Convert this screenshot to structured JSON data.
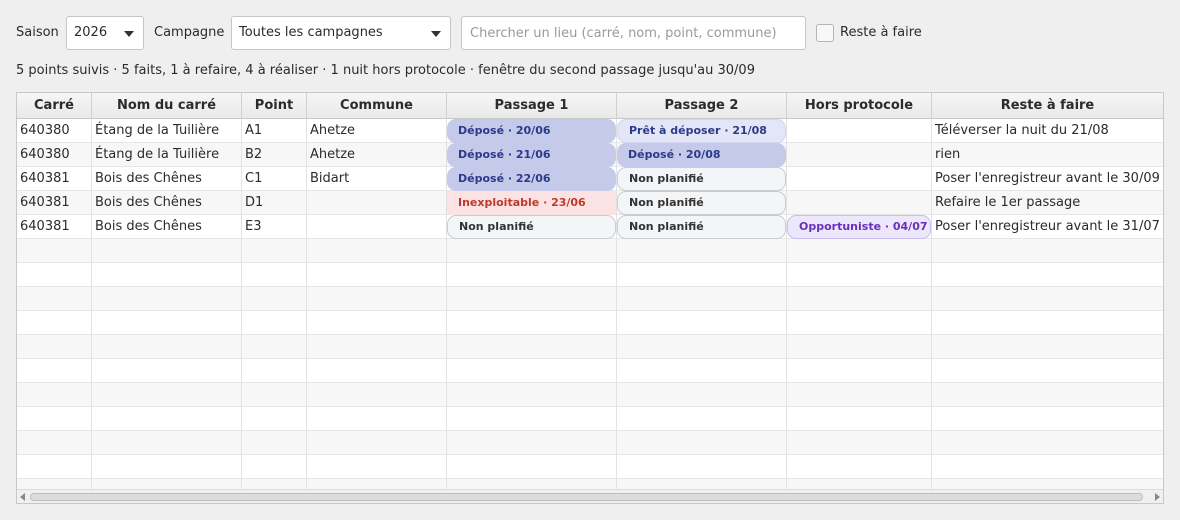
{
  "filters": {
    "season_label": "Saison",
    "season_value": "2026",
    "campaign_label": "Campagne",
    "campaign_value": "Toutes les campagnes",
    "search_placeholder": "Chercher un lieu (carré, nom, point, commune)",
    "search_value": "",
    "remaining_checkbox_label": "Reste à faire",
    "remaining_checked": false
  },
  "summary": "5 points suivis · 5 faits, 1 à refaire, 4 à réaliser · 1 nuit hors protocole · fenêtre du second passage jusqu'au 30/09",
  "table": {
    "columns": [
      "Carré",
      "Nom du carré",
      "Point",
      "Commune",
      "Passage 1",
      "Passage 2",
      "Hors protocole",
      "Reste à faire"
    ],
    "rows": [
      {
        "carre": "640380",
        "nom": "Étang de la Tuilière",
        "point": "A1",
        "commune": "Ahetze",
        "passage1": {
          "text": "Déposé · 20/06",
          "status": "depose"
        },
        "passage2": {
          "text": "Prêt à déposer · 21/08",
          "status": "pret"
        },
        "hors": null,
        "reste": "Téléverser la nuit du 21/08"
      },
      {
        "carre": "640380",
        "nom": "Étang de la Tuilière",
        "point": "B2",
        "commune": "Ahetze",
        "passage1": {
          "text": "Déposé · 21/06",
          "status": "depose"
        },
        "passage2": {
          "text": "Déposé · 20/08",
          "status": "depose"
        },
        "hors": null,
        "reste": "rien"
      },
      {
        "carre": "640381",
        "nom": "Bois des Chênes",
        "point": "C1",
        "commune": "Bidart",
        "passage1": {
          "text": "Déposé · 22/06",
          "status": "depose"
        },
        "passage2": {
          "text": "Non planifié",
          "status": "nonplan"
        },
        "hors": null,
        "reste": "Poser l'enregistreur avant le 30/09"
      },
      {
        "carre": "640381",
        "nom": "Bois des Chênes",
        "point": "D1",
        "commune": "",
        "passage1": {
          "text": "Inexploitable · 23/06",
          "status": "inexpl"
        },
        "passage2": {
          "text": "Non planifié",
          "status": "nonplan"
        },
        "hors": null,
        "reste": "Refaire le 1er passage"
      },
      {
        "carre": "640381",
        "nom": "Bois des Chênes",
        "point": "E3",
        "commune": "",
        "passage1": {
          "text": "Non planifié",
          "status": "nonplan"
        },
        "passage2": {
          "text": "Non planifié",
          "status": "nonplan"
        },
        "hors": {
          "text": "Opportuniste · 04/07",
          "status": "opport"
        },
        "reste": "Poser l'enregistreur avant le 31/07"
      }
    ],
    "status_colors": {
      "depose": "#c5c9ea",
      "pret": "#e3e6f6",
      "nonplan": "#f4f5f7",
      "inexpl": "#fbe3e3",
      "opport": "#ece7fb"
    }
  },
  "icons": {
    "dropdown": "chevron-down-icon",
    "scroll_left": "scroll-left-icon",
    "scroll_right": "scroll-right-icon"
  }
}
